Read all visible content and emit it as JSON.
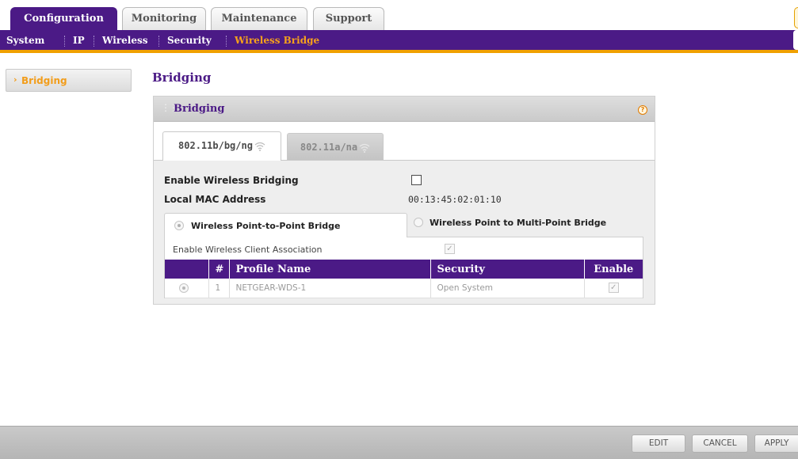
{
  "top_tabs": [
    {
      "label": "Configuration",
      "active": true
    },
    {
      "label": "Monitoring",
      "active": false
    },
    {
      "label": "Maintenance",
      "active": false
    },
    {
      "label": "Support",
      "active": false
    }
  ],
  "subnav": {
    "items": [
      "System",
      "IP",
      "Wireless",
      "Security",
      "Wireless Bridge"
    ],
    "current": "Wireless Bridge"
  },
  "leftnav": {
    "items": [
      {
        "label": "Bridging",
        "active": true
      }
    ]
  },
  "page": {
    "title": "Bridging"
  },
  "panel": {
    "title": "Bridging",
    "help_icon": "help-icon",
    "radio_tabs": [
      {
        "label": "802.11b/bg/ng",
        "icon": "wifi-icon",
        "active": true
      },
      {
        "label": "802.11a/na",
        "icon": "wifi-icon",
        "active": false
      }
    ],
    "fields": {
      "enable_bridging_label": "Enable Wireless Bridging",
      "enable_bridging_checked": false,
      "local_mac_label": "Local MAC Address",
      "local_mac_value": "00:13:45:02:01:10"
    },
    "modes": [
      {
        "label": "Wireless Point-to-Point Bridge",
        "selected": true
      },
      {
        "label": "Wireless Point to Multi-Point Bridge",
        "selected": false
      }
    ],
    "client_association": {
      "label": "Enable Wireless Client Association",
      "checked": true
    },
    "profile_table": {
      "columns": [
        "",
        "#",
        "Profile Name",
        "Security",
        "Enable"
      ],
      "rows": [
        {
          "selected": true,
          "number": "1",
          "profile_name": "NETGEAR-WDS-1",
          "security": "Open System",
          "enabled": true
        }
      ]
    }
  },
  "footer": {
    "edit_label": "EDIT",
    "cancel_label": "CANCEL",
    "apply_label": "APPLY"
  },
  "colors": {
    "brand_purple": "#4b1a86",
    "accent_orange": "#f0a000"
  }
}
